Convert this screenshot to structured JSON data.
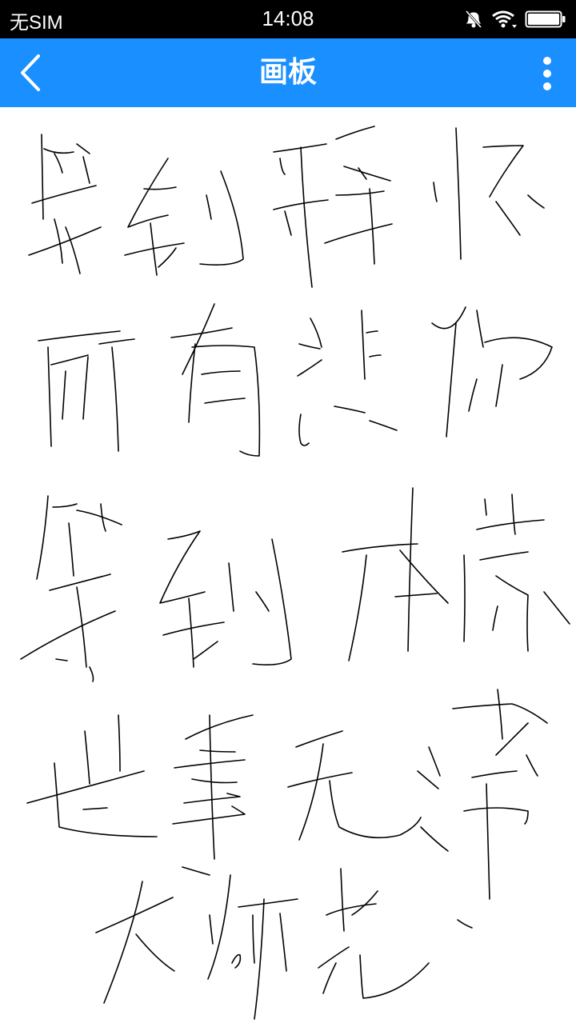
{
  "status_bar": {
    "carrier": "无SIM",
    "time": "14:08",
    "icons": [
      "mute-icon",
      "wifi-icon",
      "battery-icon"
    ]
  },
  "app_bar": {
    "title": "画板",
    "background": "#1a8fff",
    "back_icon": "chevron-left-icon",
    "menu_icon": "more-vertical-icon"
  },
  "canvas": {
    "background": "#ffffff",
    "ink_color": "#000000"
  }
}
